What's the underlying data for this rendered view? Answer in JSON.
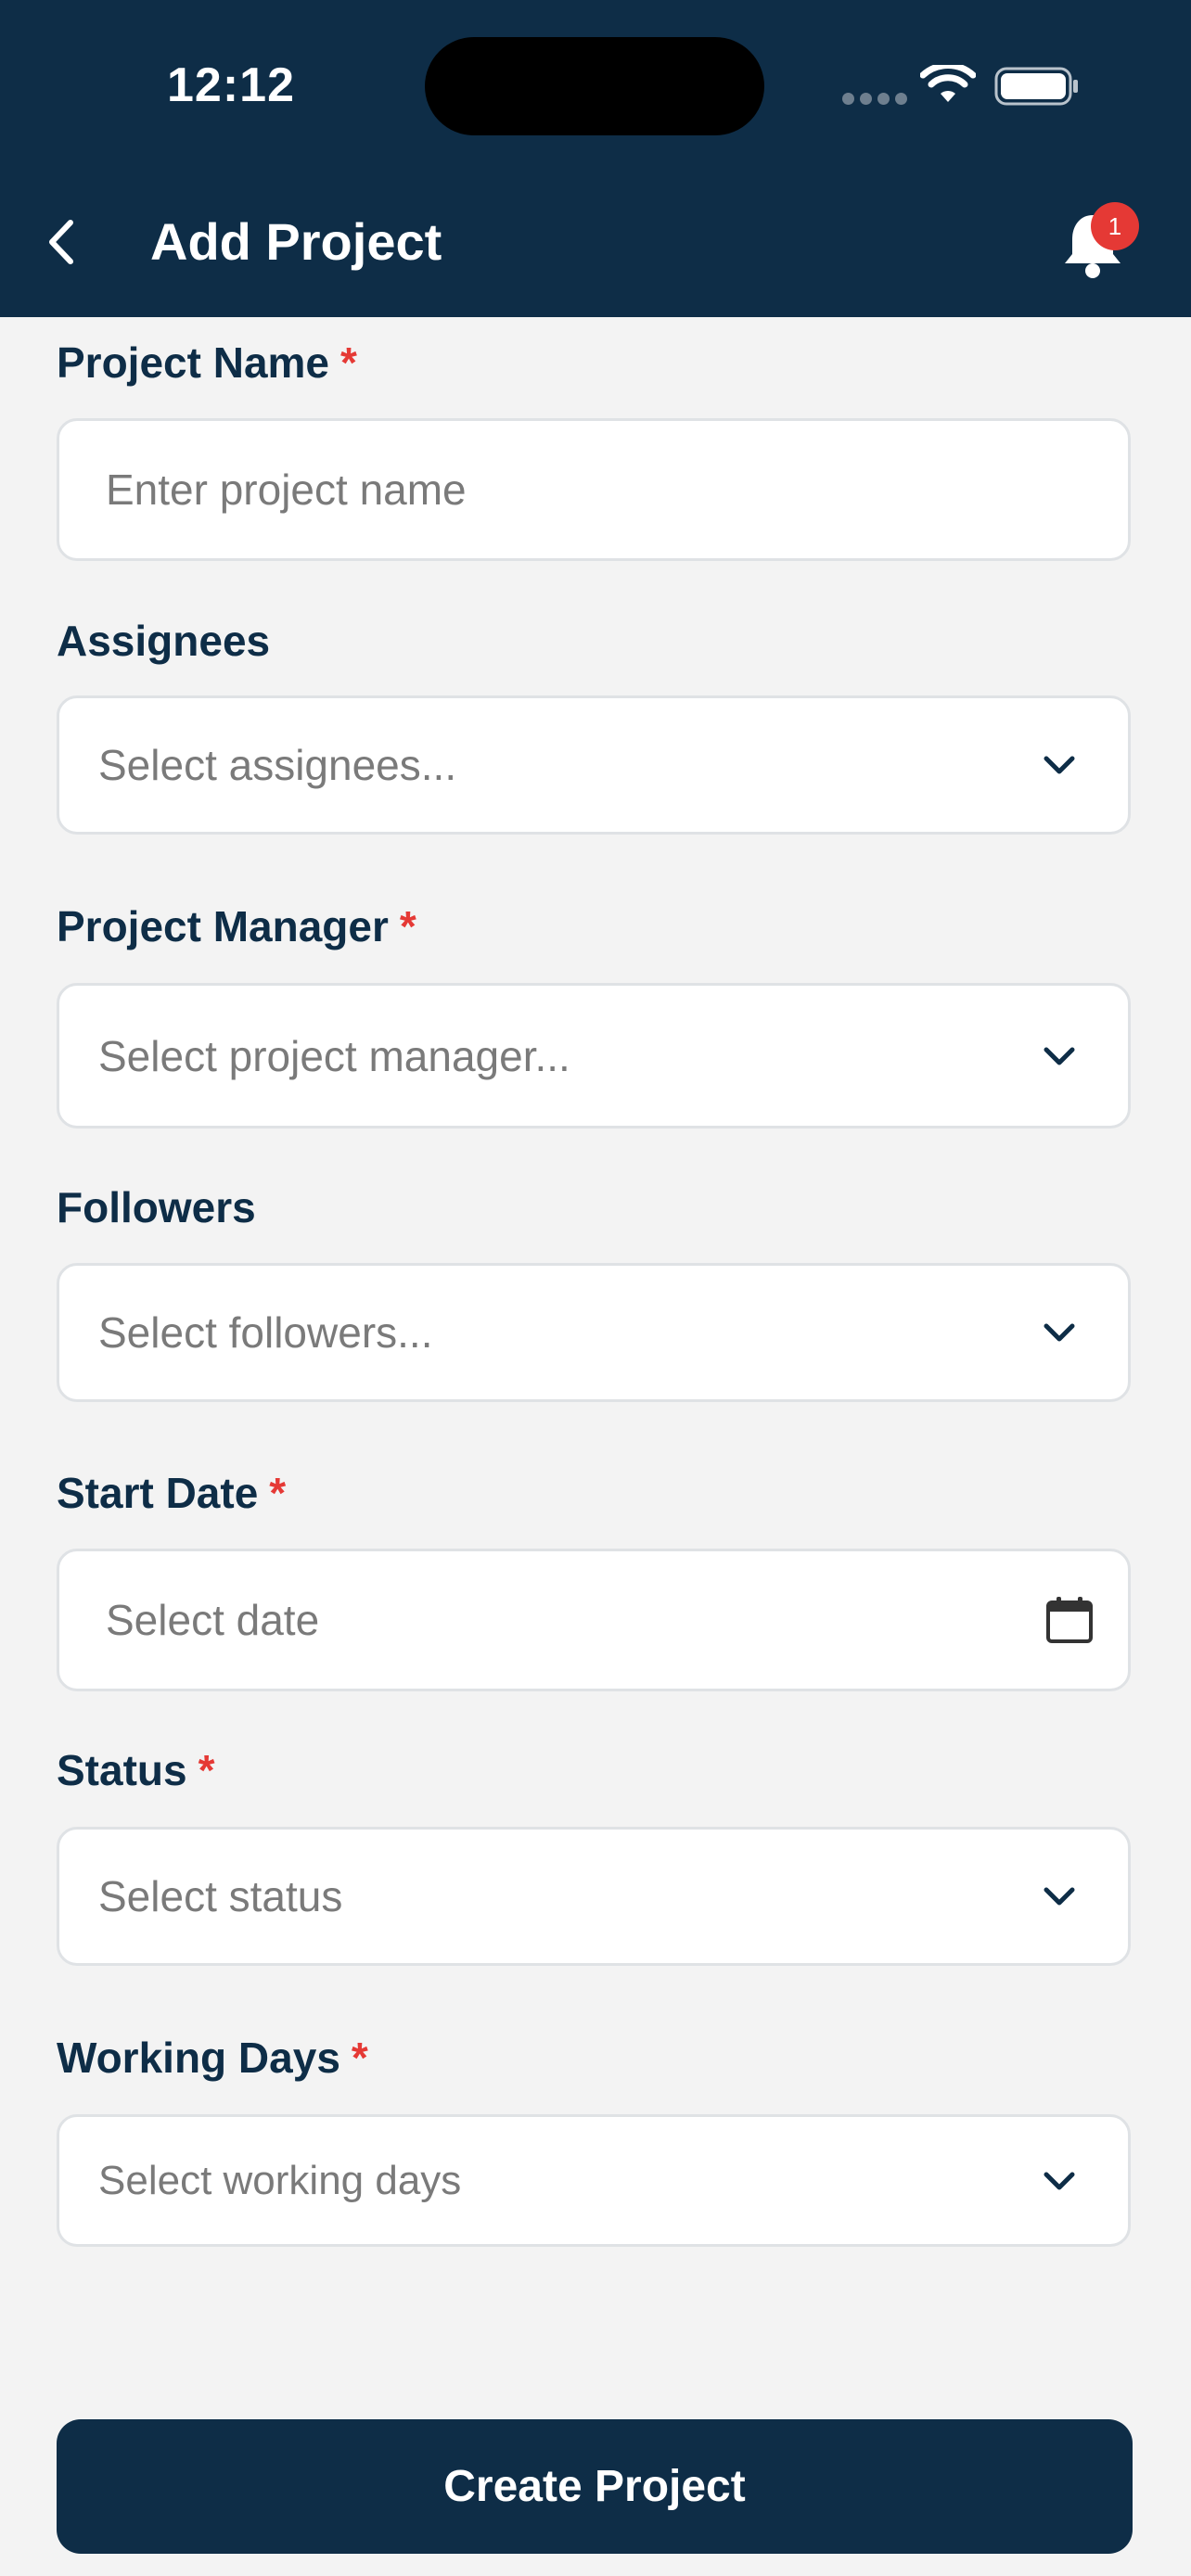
{
  "status_bar": {
    "time": "12:12"
  },
  "header": {
    "title": "Add Project",
    "notification_count": "1"
  },
  "form": {
    "required_marker": "*",
    "project_name": {
      "label": "Project Name",
      "placeholder": "Enter project name"
    },
    "assignees": {
      "label": "Assignees",
      "placeholder": "Select assignees..."
    },
    "project_manager": {
      "label": "Project Manager",
      "placeholder": "Select project manager..."
    },
    "followers": {
      "label": "Followers",
      "placeholder": "Select followers..."
    },
    "start_date": {
      "label": "Start Date",
      "placeholder": "Select date"
    },
    "status": {
      "label": "Status",
      "placeholder": "Select status"
    },
    "working_days": {
      "label": "Working Days",
      "placeholder": "Select working days"
    }
  },
  "actions": {
    "create_label": "Create Project"
  },
  "colors": {
    "primary": "#0e2d47",
    "required": "#e53935",
    "background": "#f3f3f3"
  }
}
